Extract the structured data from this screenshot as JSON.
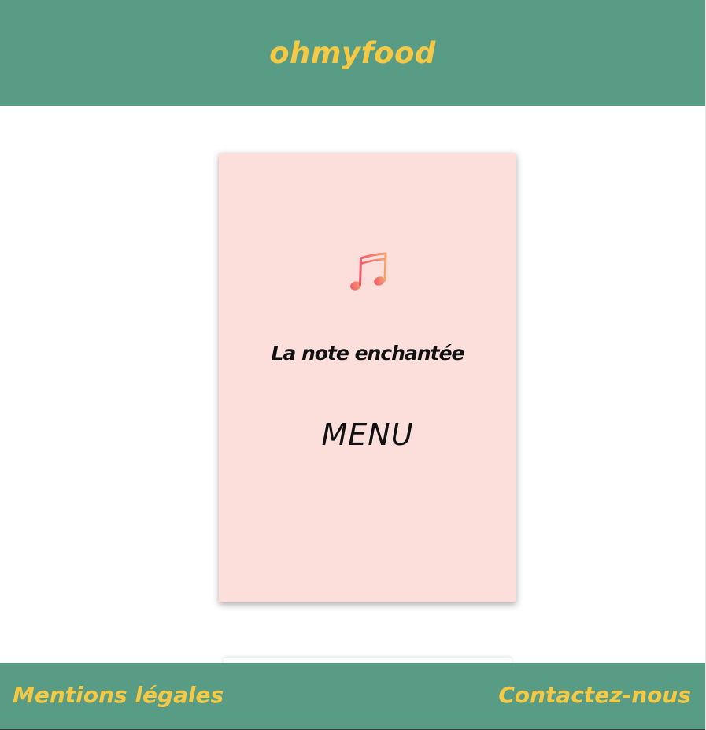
{
  "header": {
    "logo": "ohmyfood"
  },
  "card": {
    "icon": "music-note-icon",
    "restaurant_name": "La note enchantée",
    "menu_label": "MENU"
  },
  "footer": {
    "legal_label": "Mentions légales",
    "contact_label": "Contactez-nous"
  },
  "colors": {
    "brand_green": "#589c85",
    "brand_yellow": "#f6c945",
    "card_pink": "#fcdedb",
    "icon_gradient_start": "#f0576b",
    "icon_gradient_end": "#f4a36e"
  }
}
